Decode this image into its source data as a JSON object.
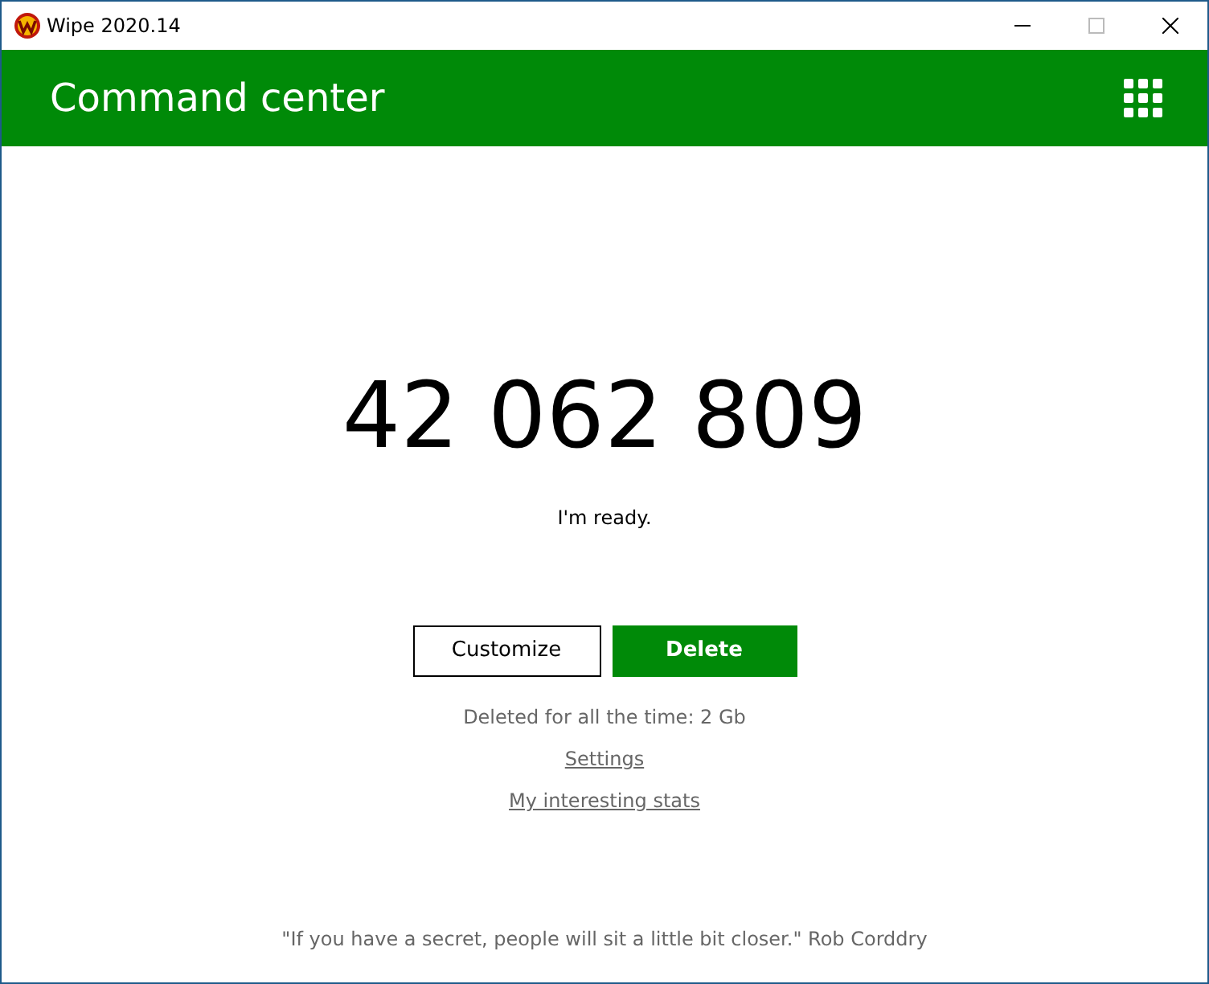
{
  "window": {
    "title": "Wipe 2020.14"
  },
  "header": {
    "title": "Command center"
  },
  "counter": "42 062 809",
  "status": "I'm ready.",
  "buttons": [
    {
      "label": "Customize",
      "kind": "outline"
    },
    {
      "label": "Delete",
      "kind": "primary"
    }
  ],
  "deleted_total": "Deleted for all the time: 2 Gb",
  "links": [
    "Settings",
    "My interesting stats"
  ],
  "quote": "\"If you have a secret, people will sit a little bit closer.\" Rob Corddry"
}
